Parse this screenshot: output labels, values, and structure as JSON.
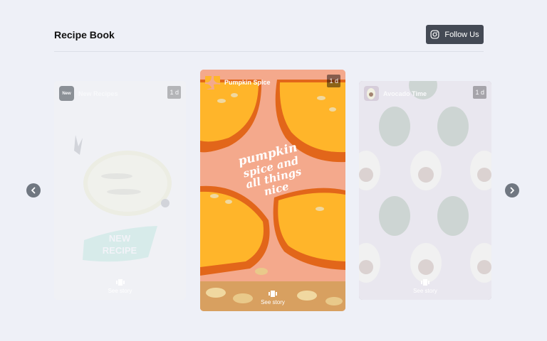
{
  "header": {
    "title": "Recipe Book",
    "follow_label": "Follow Us"
  },
  "stories": [
    {
      "name": "New Recipes",
      "avatar_text": "New",
      "age": "1 d",
      "cta": "See story",
      "sticker": "NEW RECIPE",
      "faded": true
    },
    {
      "name": "Pumpkin Spice",
      "age": "1 d",
      "cta": "See story",
      "caption": "pumpkin spice and all things nice",
      "faded": false
    },
    {
      "name": "Avocado Time",
      "age": "1 d",
      "cta": "See story",
      "faded": true
    }
  ],
  "icons": {
    "follow": "instagram-icon",
    "cta": "story-icon",
    "prev": "chevron-left-icon",
    "next": "chevron-right-icon"
  },
  "colors": {
    "background": "#eef0f7",
    "button": "#444a55",
    "arrow": "#707781"
  }
}
